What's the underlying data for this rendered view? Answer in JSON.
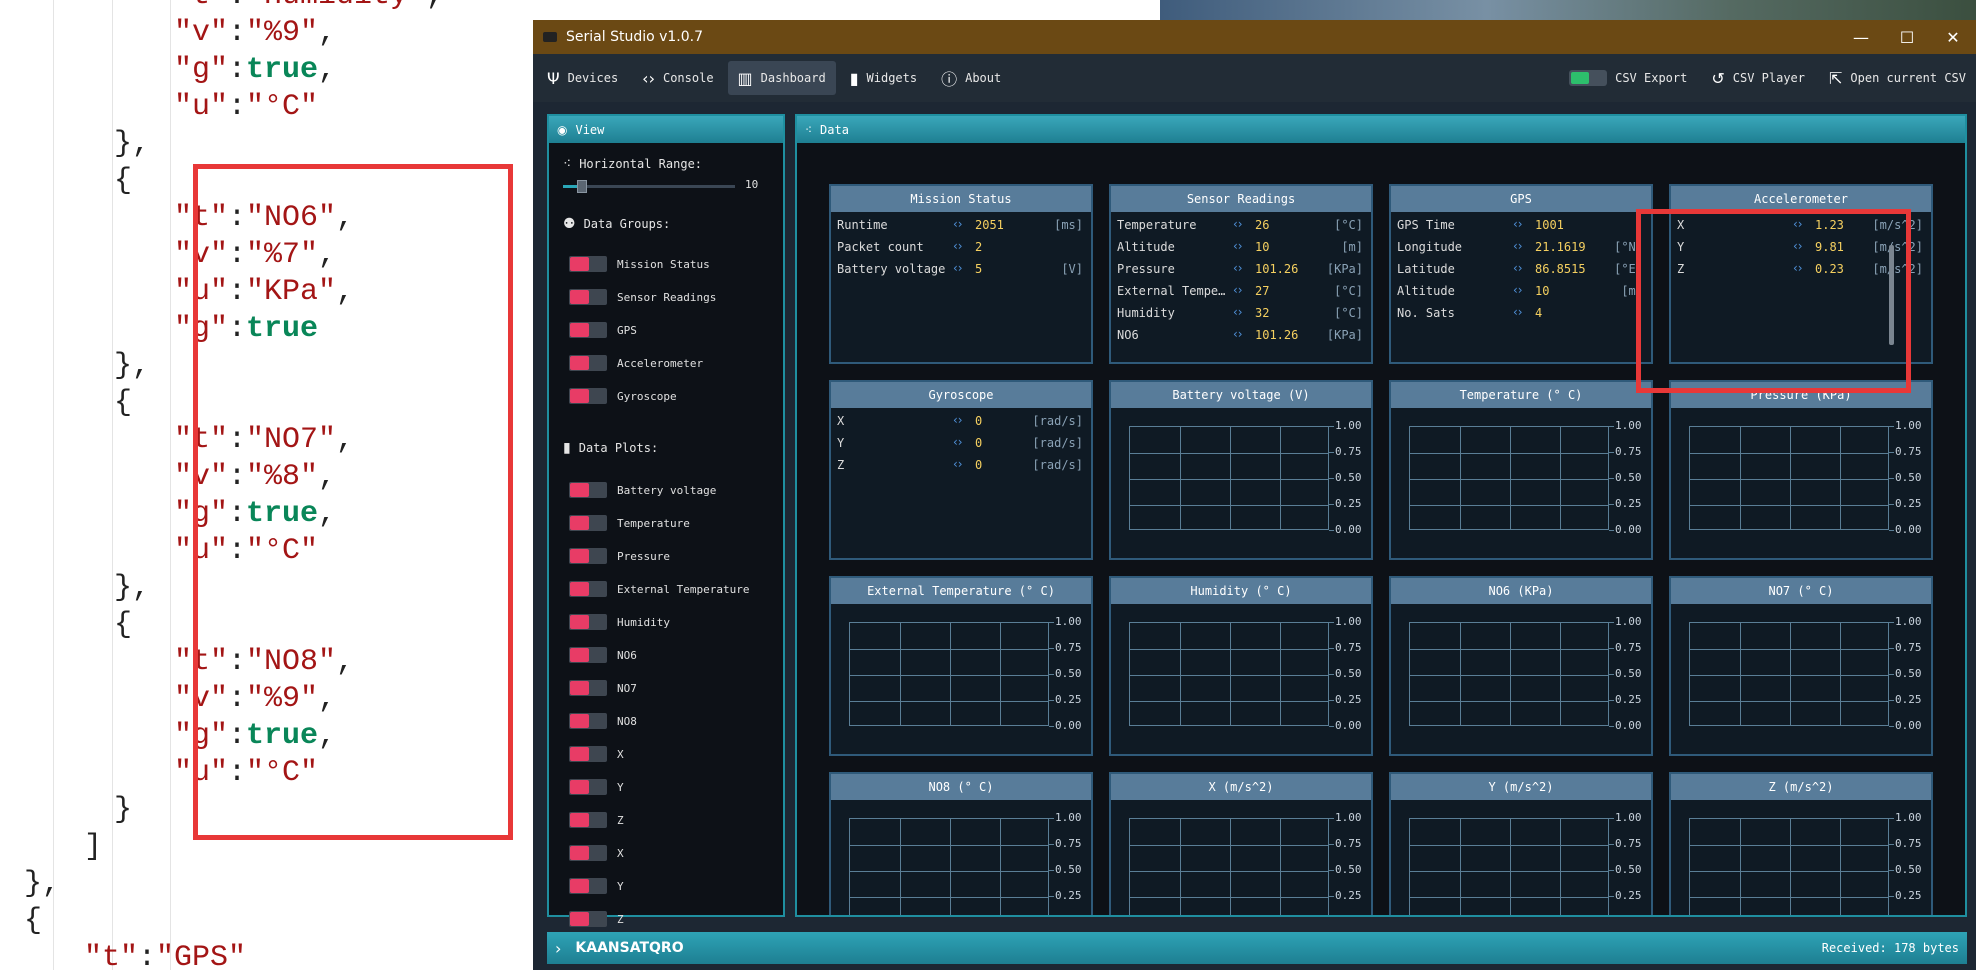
{
  "editor": {
    "lines": [
      {
        "indent": 6,
        "html": "<span class='k'>\"t\"</span>:<span class='s'>\"Humidity\"</span>,"
      },
      {
        "indent": 6,
        "html": "<span class='k'>\"v\"</span>:<span class='s'>\"%9\"</span>,"
      },
      {
        "indent": 6,
        "html": "<span class='k'>\"g\"</span>:<span class='b'>true</span>,"
      },
      {
        "indent": 6,
        "html": "<span class='k'>\"u\"</span>:<span class='s'>\"°C\"</span>"
      },
      {
        "indent": 4,
        "html": "},"
      },
      {
        "indent": 4,
        "html": "{"
      },
      {
        "indent": 6,
        "html": "<span class='k'>\"t\"</span>:<span class='s'>\"NO6\"</span>,"
      },
      {
        "indent": 6,
        "html": "<span class='k'>\"v\"</span>:<span class='s'>\"%7\"</span>,"
      },
      {
        "indent": 6,
        "html": "<span class='k'>\"u\"</span>:<span class='s'>\"KPa\"</span>,"
      },
      {
        "indent": 6,
        "html": "<span class='k'>\"g\"</span>:<span class='b'>true</span>"
      },
      {
        "indent": 4,
        "html": "},"
      },
      {
        "indent": 4,
        "html": "{"
      },
      {
        "indent": 6,
        "html": "<span class='k'>\"t\"</span>:<span class='s'>\"NO7\"</span>,"
      },
      {
        "indent": 6,
        "html": "<span class='k'>\"v\"</span>:<span class='s'>\"%8\"</span>,"
      },
      {
        "indent": 6,
        "html": "<span class='k'>\"g\"</span>:<span class='b'>true</span>,"
      },
      {
        "indent": 6,
        "html": "<span class='k'>\"u\"</span>:<span class='s'>\"°C\"</span>"
      },
      {
        "indent": 4,
        "html": "},"
      },
      {
        "indent": 4,
        "html": "{"
      },
      {
        "indent": 6,
        "html": "<span class='k'>\"t\"</span>:<span class='s'>\"NO8\"</span>,"
      },
      {
        "indent": 6,
        "html": "<span class='k'>\"v\"</span>:<span class='s'>\"%9\"</span>,"
      },
      {
        "indent": 6,
        "html": "<span class='k'>\"g\"</span>:<span class='b'>true</span>,"
      },
      {
        "indent": 6,
        "html": "<span class='k'>\"u\"</span>:<span class='s'>\"°C\"</span>"
      },
      {
        "indent": 4,
        "html": "}"
      },
      {
        "indent": 3,
        "html": "]"
      },
      {
        "indent": 1,
        "html": "},"
      },
      {
        "indent": 1,
        "html": "{"
      },
      {
        "indent": 3,
        "html": "<span class='k'>\"t\"</span>:<span class='s'>\"GPS\"</span>"
      }
    ]
  },
  "window": {
    "title": "Serial Studio v1.0.7",
    "controls": [
      "—",
      "☐",
      "✕"
    ]
  },
  "toolbar": {
    "items": [
      {
        "label": "Devices",
        "icon": "Ψ",
        "active": false
      },
      {
        "label": "Console",
        "icon": "‹›",
        "active": false
      },
      {
        "label": "Dashboard",
        "icon": "▥",
        "active": true
      },
      {
        "label": "Widgets",
        "icon": "▮",
        "active": false
      },
      {
        "label": "About",
        "icon": "ⓘ",
        "active": false
      }
    ],
    "csv_export": "CSV Export",
    "csv_player": "CSV Player",
    "open_csv": "Open current CSV"
  },
  "view": {
    "title": "View",
    "horizontal_range_label": "Horizontal Range:",
    "horizontal_range_value": "10",
    "data_groups_label": "Data Groups:",
    "data_groups": [
      "Mission Status",
      "Sensor Readings",
      "GPS",
      "Accelerometer",
      "Gyroscope"
    ],
    "data_plots_label": "Data Plots:",
    "data_plots": [
      "Battery voltage",
      "Temperature",
      "Pressure",
      "External Temperature",
      "Humidity",
      "NO6",
      "NO7",
      "NO8",
      "X",
      "Y",
      "Z",
      "X",
      "Y",
      "Z"
    ]
  },
  "data": {
    "title": "Data",
    "groups": [
      {
        "title": "Mission Status",
        "rows": [
          {
            "t": "Runtime",
            "v": "2051",
            "u": "[ms]"
          },
          {
            "t": "Packet count",
            "v": "2",
            "u": ""
          },
          {
            "t": "Battery voltage",
            "v": "5",
            "u": "[V]"
          }
        ]
      },
      {
        "title": "Sensor Readings",
        "rows": [
          {
            "t": "Temperature",
            "v": "26",
            "u": "[°C]"
          },
          {
            "t": "Altitude",
            "v": "10",
            "u": "[m]"
          },
          {
            "t": "Pressure",
            "v": "101.26",
            "u": "[KPa]"
          },
          {
            "t": "External Temperature",
            "v": "27",
            "u": "[°C]"
          },
          {
            "t": "Humidity",
            "v": "32",
            "u": "[°C]"
          },
          {
            "t": "NO6",
            "v": "101.26",
            "u": "[KPa]"
          }
        ]
      },
      {
        "title": "GPS",
        "rows": [
          {
            "t": "GPS Time",
            "v": "1001",
            "u": ""
          },
          {
            "t": "Longitude",
            "v": "21.1619",
            "u": "[°N]"
          },
          {
            "t": "Latitude",
            "v": "86.8515",
            "u": "[°E]"
          },
          {
            "t": "Altitude",
            "v": "10",
            "u": "[m]"
          },
          {
            "t": "No. Sats",
            "v": "4",
            "u": ""
          }
        ]
      },
      {
        "title": "Accelerometer",
        "rows": [
          {
            "t": "X",
            "v": "1.23",
            "u": "[m/s^2]"
          },
          {
            "t": "Y",
            "v": "9.81",
            "u": "[m/s^2]"
          },
          {
            "t": "Z",
            "v": "0.23",
            "u": "[m/s^2]"
          }
        ]
      },
      {
        "title": "Gyroscope",
        "rows": [
          {
            "t": "X",
            "v": "0",
            "u": "[rad/s]"
          },
          {
            "t": "Y",
            "v": "0",
            "u": "[rad/s]"
          },
          {
            "t": "Z",
            "v": "0",
            "u": "[rad/s]"
          }
        ]
      }
    ],
    "plots": [
      "Battery voltage (V)",
      "Temperature (° C)",
      "Pressure (KPa)",
      "External Temperature (° C)",
      "Humidity (° C)",
      "NO6 (KPa)",
      "NO7 (° C)",
      "NO8 (° C)",
      "X (m/s^2)",
      "Y (m/s^2)",
      "Z (m/s^2)"
    ],
    "plot_ticks": [
      "1.00",
      "0.75",
      "0.50",
      "0.25",
      "0.00"
    ]
  },
  "statusbar": {
    "project_name": "KAANSATQRO",
    "received": "Received: 178 bytes"
  },
  "colors": {
    "accent": "#1f8fa0",
    "toggle_on": "#e83c66",
    "highlight": "#e83838",
    "value": "#f5d060"
  }
}
